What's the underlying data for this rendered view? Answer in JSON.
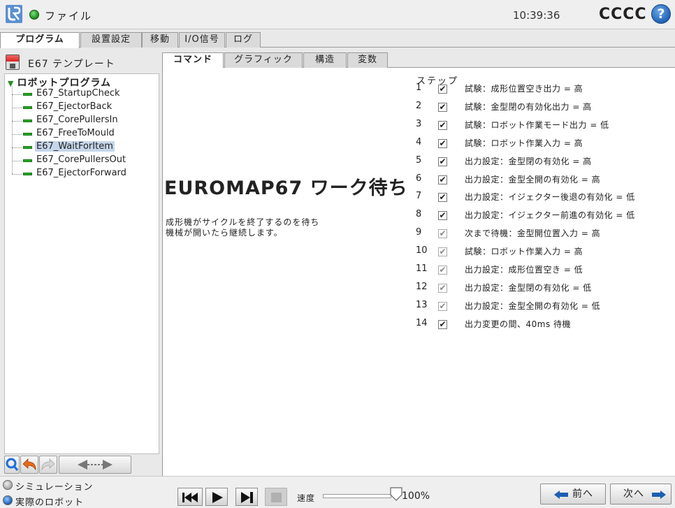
{
  "header": {
    "file_menu": "ファイル",
    "clock": "10:39:36",
    "robot_name": "CCCC",
    "help_glyph": "?"
  },
  "main_tabs": [
    "プログラム",
    "設置設定",
    "移動",
    "I/O信号",
    "ログ"
  ],
  "left_panel": {
    "template_name": "E67 テンプレート",
    "tree": {
      "root": "ロボットプログラム",
      "items": [
        "E67_StartupCheck",
        "E67_EjectorBack",
        "E67_CorePullersIn",
        "E67_FreeToMould",
        "E67_WaitForItem",
        "E67_CorePullersOut",
        "E67_EjectorForward"
      ],
      "selected_index": 4
    }
  },
  "sub_tabs": [
    "コマンド",
    "グラフィック",
    "構造",
    "変数"
  ],
  "command": {
    "title": "EUROMAP67 ワーク待ち",
    "description_line1": "成形機がサイクルを終了するのを待ち",
    "description_line2": "機械が開いたら継続します。"
  },
  "steps": {
    "header": "ステップ",
    "rows": [
      {
        "num": "1",
        "checked": true,
        "dim": false,
        "text": "試験：成形位置空き出力 = 高"
      },
      {
        "num": "2",
        "checked": true,
        "dim": false,
        "text": "試験：金型閉の有効化出力 = 高"
      },
      {
        "num": "3",
        "checked": true,
        "dim": false,
        "text": "試験：ロボット作業モード出力 = 低"
      },
      {
        "num": "4",
        "checked": true,
        "dim": false,
        "text": "試験：ロボット作業入力 = 高"
      },
      {
        "num": "5",
        "checked": true,
        "dim": false,
        "text": "出力設定：金型閉の有効化 = 高"
      },
      {
        "num": "6",
        "checked": true,
        "dim": false,
        "text": "出力設定：金型全開の有効化 = 高"
      },
      {
        "num": "7",
        "checked": true,
        "dim": false,
        "text": "出力設定：イジェクター後退の有効化 = 低"
      },
      {
        "num": "8",
        "checked": true,
        "dim": false,
        "text": "出力設定：イジェクター前進の有効化 = 低"
      },
      {
        "num": "9",
        "checked": true,
        "dim": true,
        "text": "次まで待機：金型開位置入力 = 高"
      },
      {
        "num": "10",
        "checked": true,
        "dim": true,
        "text": "試験：ロボット作業入力 = 高"
      },
      {
        "num": "11",
        "checked": true,
        "dim": true,
        "text": "出力設定：成形位置空き = 低"
      },
      {
        "num": "12",
        "checked": true,
        "dim": true,
        "text": "出力設定：金型閉の有効化 = 低"
      },
      {
        "num": "13",
        "checked": true,
        "dim": true,
        "text": "出力設定：金型全開の有効化 = 低"
      },
      {
        "num": "14",
        "checked": true,
        "dim": false,
        "text": "出力変更の間、40ms 待機"
      }
    ],
    "check_glyph": "✔"
  },
  "bottom": {
    "mode_simulation": "シミュレーション",
    "mode_real": "実際のロボット",
    "speed_label": "速度",
    "speed_value": "100%",
    "speed_level": 1.0,
    "prev_label": "前へ",
    "next_label": "次へ"
  },
  "colors": {
    "accent_blue": "#1d5fb0",
    "status_green": "#1a8a1a",
    "selection": "#c6d6ea"
  },
  "icons": [
    "ur-logo-icon",
    "status-dot-icon",
    "help-icon",
    "save-icon",
    "search-icon",
    "undo-icon",
    "redo-icon",
    "move-arrows-icon",
    "skip-back-icon",
    "play-icon",
    "step-forward-icon",
    "stop-icon",
    "slider-handle-icon",
    "arrow-left-icon",
    "arrow-right-icon"
  ]
}
